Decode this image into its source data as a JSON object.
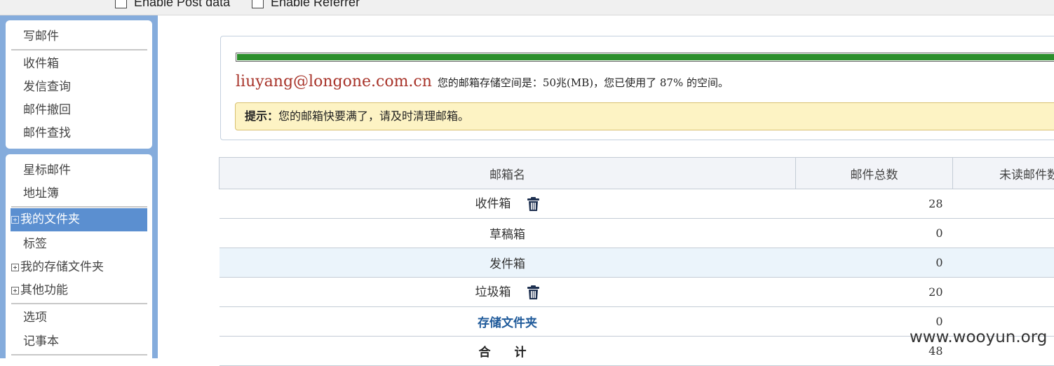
{
  "topbar": {
    "enable_post": "Enable Post data",
    "enable_referrer": "Enable Referrer"
  },
  "sidebar": {
    "group1": [
      "写邮件",
      "收件箱",
      "发信查询",
      "邮件撤回",
      "邮件查找"
    ],
    "starred": "星标邮件",
    "address_book": "地址簿",
    "my_folders": "我的文件夹",
    "tags": "标签",
    "my_storage_folders": "我的存储文件夹",
    "other_functions": "其他功能",
    "options": "选项",
    "notepad": "记事本"
  },
  "quota": {
    "email": "liuyang@longone.com.cn",
    "text": "您的邮箱存储空间是：50兆(MB)，您已使用了 87% 的空间。",
    "used_percent": 87,
    "bar_color": "#2c8f2c",
    "tip_label": "提示：",
    "tip_text": "您的邮箱快要满了，请及时清理邮箱。"
  },
  "table": {
    "headers": [
      "邮箱名",
      "邮件总数",
      "未读邮件数"
    ],
    "rows": [
      {
        "name": "收件箱",
        "total": "28",
        "has_trash": true
      },
      {
        "name": "草稿箱",
        "total": "0",
        "has_trash": false
      },
      {
        "name": "发件箱",
        "total": "0",
        "has_trash": false
      },
      {
        "name": "垃圾箱",
        "total": "20",
        "has_trash": true
      },
      {
        "name": "存储文件夹",
        "total": "0",
        "has_trash": false
      },
      {
        "name": "合 计",
        "total": "48",
        "has_trash": false
      }
    ]
  },
  "watermark": "www.wooyun.org"
}
